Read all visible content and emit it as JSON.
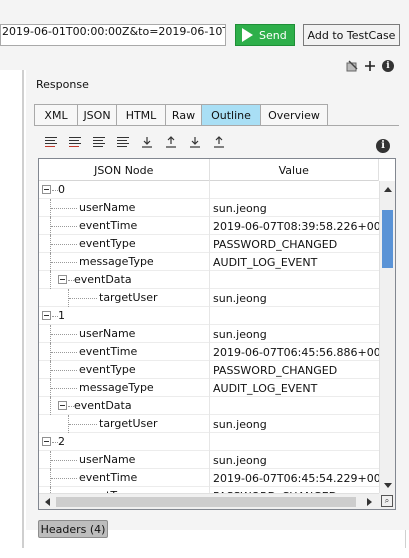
{
  "request": {
    "url_value": "2019-06-01T00:00:00Z&to=2019-06-10T00:",
    "send_label": "Send",
    "add_testcase_label": "Add to TestCase"
  },
  "response": {
    "label": "Response",
    "tabs": [
      {
        "label": "XML",
        "active": false
      },
      {
        "label": "JSON",
        "active": false
      },
      {
        "label": "HTML",
        "active": false
      },
      {
        "label": "Raw",
        "active": false
      },
      {
        "label": "Outline",
        "active": true
      },
      {
        "label": "Overview",
        "active": false
      }
    ],
    "tree": {
      "columns": [
        "JSON Node",
        "Value"
      ],
      "rows": [
        {
          "node": "0",
          "value": "",
          "level": 0,
          "expander": true
        },
        {
          "node": "userName",
          "value": "sun.jeong",
          "level": 1,
          "expander": false
        },
        {
          "node": "eventTime",
          "value": "2019-06-07T08:39:58.226+0000",
          "level": 1,
          "expander": false
        },
        {
          "node": "eventType",
          "value": "PASSWORD_CHANGED",
          "level": 1,
          "expander": false
        },
        {
          "node": "messageType",
          "value": "AUDIT_LOG_EVENT",
          "level": 1,
          "expander": false
        },
        {
          "node": "eventData",
          "value": "",
          "level": 1,
          "expander": true
        },
        {
          "node": "targetUser",
          "value": "sun.jeong",
          "level": 2,
          "expander": false
        },
        {
          "node": "1",
          "value": "",
          "level": 0,
          "expander": true
        },
        {
          "node": "userName",
          "value": "sun.jeong",
          "level": 1,
          "expander": false
        },
        {
          "node": "eventTime",
          "value": "2019-06-07T06:45:56.886+0000",
          "level": 1,
          "expander": false
        },
        {
          "node": "eventType",
          "value": "PASSWORD_CHANGED",
          "level": 1,
          "expander": false
        },
        {
          "node": "messageType",
          "value": "AUDIT_LOG_EVENT",
          "level": 1,
          "expander": false
        },
        {
          "node": "eventData",
          "value": "",
          "level": 1,
          "expander": true
        },
        {
          "node": "targetUser",
          "value": "sun.jeong",
          "level": 2,
          "expander": false
        },
        {
          "node": "2",
          "value": "",
          "level": 0,
          "expander": true
        },
        {
          "node": "userName",
          "value": "sun.jeong",
          "level": 1,
          "expander": false
        },
        {
          "node": "eventTime",
          "value": "2019-06-07T06:45:54.229+0000",
          "level": 1,
          "expander": false
        },
        {
          "node": "eventType",
          "value": "PASSWORD_CHANGED",
          "level": 1,
          "expander": false
        }
      ]
    },
    "vertical_scroll_fraction": 0.05
  },
  "footer": {
    "headers_label": "Headers (4)"
  },
  "colors": {
    "send_green": "#2eaf4a",
    "active_tab": "#a9dff5",
    "scroll_thumb": "#5a93d6"
  },
  "icons": [
    "play-icon",
    "clear-icon",
    "plus-icon",
    "info-icon",
    "collapse-icon",
    "expand-icon",
    "zoom-icon"
  ]
}
